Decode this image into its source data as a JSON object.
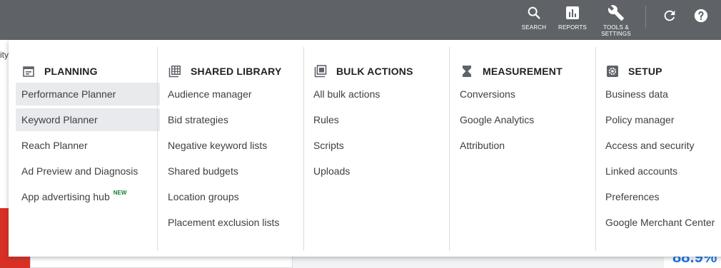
{
  "topbar": {
    "search_label": "SEARCH",
    "reports_label": "REPORTS",
    "tools_label": "TOOLS &\nSETTINGS",
    "icons": [
      "search-icon",
      "reports-icon",
      "wrench-icon",
      "refresh-icon",
      "help-icon"
    ]
  },
  "background": {
    "cut_text": "ity",
    "percent": "88.9%"
  },
  "menu": {
    "planning": {
      "title": "PLANNING",
      "items": [
        "Performance Planner",
        "Keyword Planner",
        "Reach Planner",
        "Ad Preview and Diagnosis",
        "App advertising hub"
      ],
      "new_badge": "NEW"
    },
    "shared_library": {
      "title": "SHARED LIBRARY",
      "items": [
        "Audience manager",
        "Bid strategies",
        "Negative keyword lists",
        "Shared budgets",
        "Location groups",
        "Placement exclusion lists"
      ]
    },
    "bulk_actions": {
      "title": "BULK ACTIONS",
      "items": [
        "All bulk actions",
        "Rules",
        "Scripts",
        "Uploads"
      ]
    },
    "measurement": {
      "title": "MEASUREMENT",
      "items": [
        "Conversions",
        "Google Analytics",
        "Attribution"
      ]
    },
    "setup": {
      "title": "SETUP",
      "items": [
        "Business data",
        "Policy manager",
        "Access and security",
        "Linked accounts",
        "Preferences",
        "Google Merchant Center"
      ]
    }
  },
  "colors": {
    "topbar": "#5f6368",
    "highlight": "#e8eaed",
    "new_badge": "#188038",
    "percent": "#1a73e8"
  }
}
